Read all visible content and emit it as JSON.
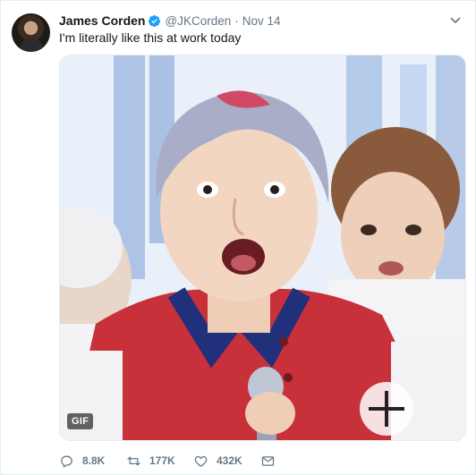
{
  "author": {
    "name": "James Corden",
    "handle": "@JKCorden",
    "separator": "·",
    "date": "Nov 14",
    "verified": true
  },
  "tweet": {
    "text": "I'm literally like this at work today"
  },
  "media": {
    "type_badge": "GIF"
  },
  "actions": {
    "replies": "8.8K",
    "retweets": "177K",
    "likes": "432K"
  },
  "colors": {
    "verified_blue": "#1da1f2",
    "muted": "#657786",
    "text": "#14171a"
  },
  "icons": {
    "verified": "verified-badge-icon",
    "caret": "chevron-down-icon",
    "reply": "reply-icon",
    "retweet": "retweet-icon",
    "like": "heart-icon",
    "dm": "envelope-icon"
  }
}
